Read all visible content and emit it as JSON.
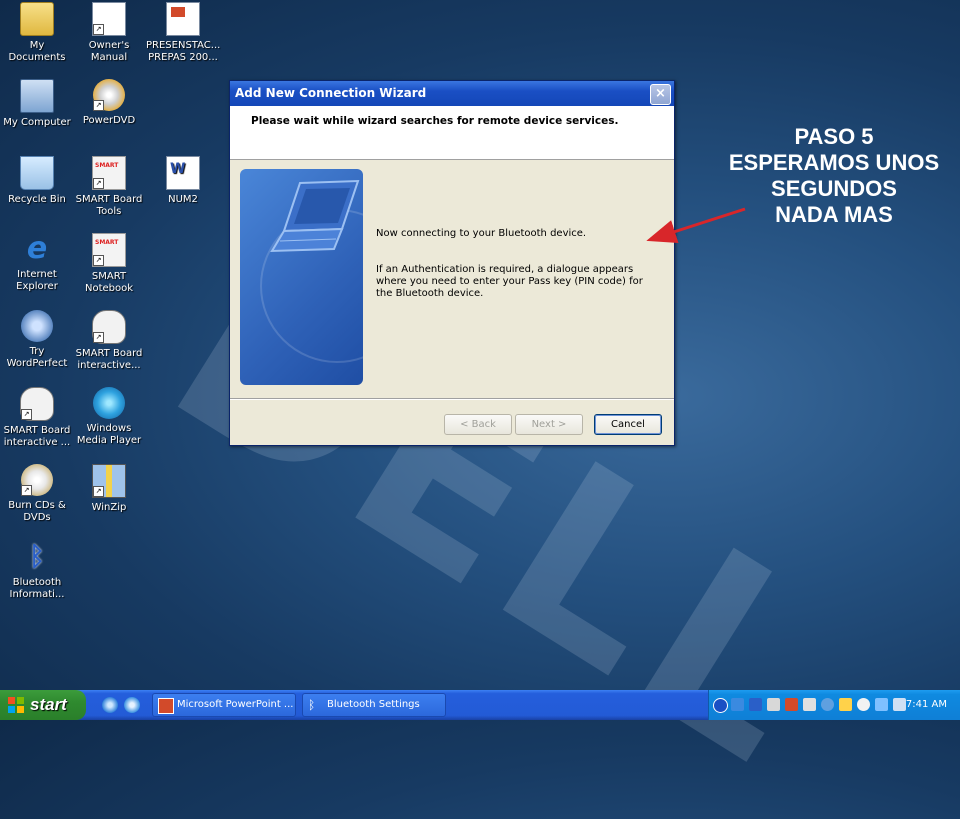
{
  "desktop": {
    "icons": [
      {
        "label": "My Documents",
        "icon": "folder-icon"
      },
      {
        "label": "Owner's Manual",
        "icon": "document-icon"
      },
      {
        "label": "PRESENSTAC... PREPAS 200...",
        "icon": "powerpoint-icon"
      },
      {
        "label": "My Computer",
        "icon": "computer-icon"
      },
      {
        "label": "PowerDVD",
        "icon": "dvd-icon"
      },
      {
        "label": "Recycle Bin",
        "icon": "recycle-bin-icon"
      },
      {
        "label": "SMART Board Tools",
        "icon": "smart-board-icon"
      },
      {
        "label": "NUM2",
        "icon": "word-document-icon"
      },
      {
        "label": "Internet Explorer",
        "icon": "internet-explorer-icon"
      },
      {
        "label": "SMART Notebook",
        "icon": "smart-notebook-icon"
      },
      {
        "label": "Try WordPerfect",
        "icon": "wordperfect-icon"
      },
      {
        "label": "SMART Board interactive...",
        "icon": "mouse-icon"
      },
      {
        "label": "SMART Board interactive ...",
        "icon": "mouse-icon"
      },
      {
        "label": "Windows Media Player",
        "icon": "media-player-icon"
      },
      {
        "label": "Burn CDs & DVDs",
        "icon": "cd-icon"
      },
      {
        "label": "WinZip",
        "icon": "winzip-icon"
      },
      {
        "label": "Bluetooth Informati...",
        "icon": "bluetooth-icon"
      }
    ]
  },
  "wizard": {
    "title": "Add New Connection Wizard",
    "header": "Please wait while wizard searches for remote device services.",
    "message1": "Now connecting to your Bluetooth device.",
    "message2": "If an Authentication is required, a dialogue appears where you need to enter your Pass key (PIN code) for the Bluetooth device.",
    "buttons": {
      "back": "< Back",
      "next": "Next >",
      "cancel": "Cancel"
    },
    "close_glyph": "×"
  },
  "annotation": {
    "line1": "PASO 5",
    "line2": "ESPERAMOS UNOS",
    "line3": "SEGUNDOS",
    "line4": "NADA MAS",
    "arrow_color": "#d8262a"
  },
  "taskbar": {
    "start_label": "start",
    "tasks": [
      {
        "label": "Microsoft PowerPoint ...",
        "icon": "powerpoint-icon"
      },
      {
        "label": "Bluetooth Settings",
        "icon": "bluetooth-icon"
      }
    ],
    "clock": "7:41 AM"
  },
  "colors": {
    "titlebar": "#1a4fc4",
    "dialog_bg": "#ece9d8",
    "taskbar": "#245edc",
    "start_button": "#2f8a2f",
    "tray": "#0f8ae0"
  }
}
